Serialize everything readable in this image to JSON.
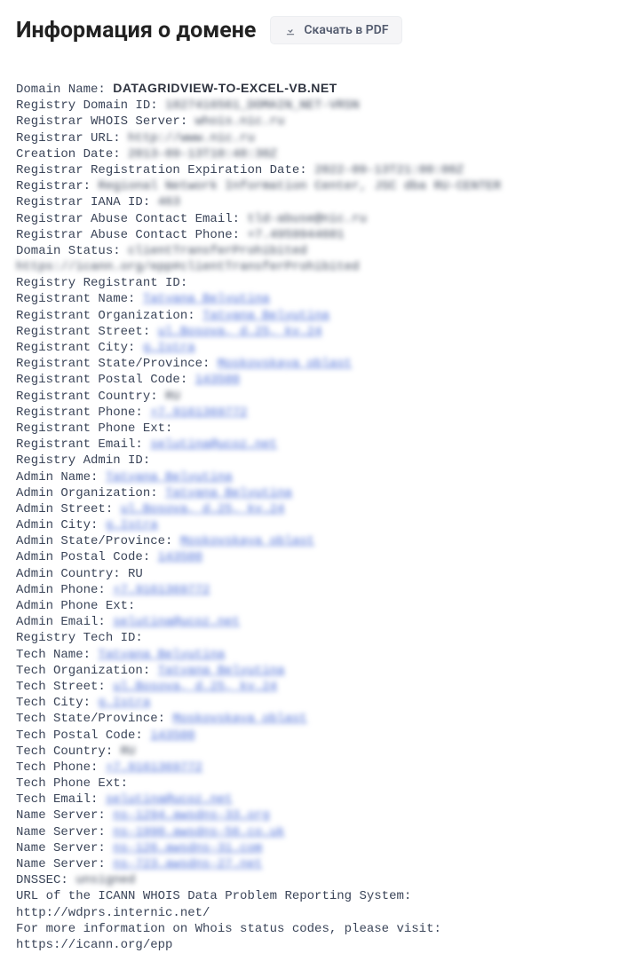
{
  "header": {
    "title": "Информация о домене",
    "pdf_button": "Скачать в PDF"
  },
  "whois": {
    "domain_name_label": "Domain Name:",
    "domain_name_value": "DATAGRIDVIEW-TO-EXCEL-VB.NET",
    "registry_domain_id_label": "Registry Domain ID:",
    "registry_domain_id_value": "1827416561_DOMAIN_NET-VRSN",
    "registrar_whois_server_label": "Registrar WHOIS Server:",
    "registrar_whois_server_value": "whois.nic.ru",
    "registrar_url_label": "Registrar URL:",
    "registrar_url_value": "http://www.nic.ru",
    "creation_date_label": "Creation Date:",
    "creation_date_value": "2013-09-13T10:48:30Z",
    "expiration_date_label": "Registrar Registration Expiration Date:",
    "expiration_date_value": "2022-09-13T21:00:00Z",
    "registrar_label": "Registrar:",
    "registrar_value": "Regional Network Information Center, JSC dba RU-CENTER",
    "registrar_iana_id_label": "Registrar IANA ID:",
    "registrar_iana_id_value": "463",
    "registrar_abuse_email_label": "Registrar Abuse Contact Email:",
    "registrar_abuse_email_value": "tld-abuse@nic.ru",
    "registrar_abuse_phone_label": "Registrar Abuse Contact Phone:",
    "registrar_abuse_phone_value": "+7.4959944601",
    "domain_status_label": "Domain Status:",
    "domain_status_value": "clientTransferProhibited https://icann.org/epp#clientTransferProhibited",
    "registry_registrant_id_label": "Registry Registrant ID:",
    "registrant_name_label": "Registrant Name:",
    "registrant_name_value": "Tatyana Belyutina",
    "registrant_org_label": "Registrant Organization:",
    "registrant_org_value": "Tatyana Belyutina",
    "registrant_street_label": "Registrant Street:",
    "registrant_street_value": "ul.Bosova, d.25, kv.24",
    "registrant_city_label": "Registrant City:",
    "registrant_city_value": "g.Istra",
    "registrant_state_label": "Registrant State/Province:",
    "registrant_state_value": "Moskovskaya oblast",
    "registrant_postal_label": "Registrant Postal Code:",
    "registrant_postal_value": "143500",
    "registrant_country_label": "Registrant Country:",
    "registrant_country_value": "RU",
    "registrant_phone_label": "Registrant Phone:",
    "registrant_phone_value": "+7.9161369772",
    "registrant_phone_ext_label": "Registrant Phone Ext:",
    "registrant_email_label": "Registrant Email:",
    "registrant_email_value": "selutina@ucoz.net",
    "registry_admin_id_label": "Registry Admin ID:",
    "admin_name_label": "Admin Name:",
    "admin_name_value": "Tatyana Belyutina",
    "admin_org_label": "Admin Organization:",
    "admin_org_value": "Tatyana Belyutina",
    "admin_street_label": "Admin Street:",
    "admin_street_value": "ul.Bosova, d.25, kv.24",
    "admin_city_label": "Admin City:",
    "admin_city_value": "g.Istra",
    "admin_state_label": "Admin State/Province:",
    "admin_state_value": "Moskovskaya oblast",
    "admin_postal_label": "Admin Postal Code:",
    "admin_postal_value": "143500",
    "admin_country_label": "Admin Country: RU",
    "admin_phone_label": "Admin Phone:",
    "admin_phone_value": "+7.9161369772",
    "admin_phone_ext_label": "Admin Phone Ext:",
    "admin_email_label": "Admin Email:",
    "admin_email_value": "selutina@ucoz.net",
    "registry_tech_id_label": "Registry Tech ID:",
    "tech_name_label": "Tech Name:",
    "tech_name_value": "Tatyana Belyutina",
    "tech_org_label": "Tech Organization:",
    "tech_org_value": "Tatyana Belyutina",
    "tech_street_label": "Tech Street:",
    "tech_street_value": "ul.Bosova, d.25, kv.24",
    "tech_city_label": "Tech City:",
    "tech_city_value": "g.Istra",
    "tech_state_label": "Tech State/Province:",
    "tech_state_value": "Moskovskaya oblast",
    "tech_postal_label": "Tech Postal Code:",
    "tech_postal_value": "143500",
    "tech_country_label": "Tech Country:",
    "tech_country_value": "RU",
    "tech_phone_label": "Tech Phone:",
    "tech_phone_value": "+7.9161369772",
    "tech_phone_ext_label": "Tech Phone Ext:",
    "tech_email_label": "Tech Email:",
    "tech_email_value": "selutina@ucoz.net",
    "ns_label": "Name Server:",
    "ns1_value": "ns-1294.awsdns-33.org",
    "ns2_value": "ns-1990.awsdns-56.co.uk",
    "ns3_value": "ns-126.awsdns-31.com",
    "ns4_value": "ns-723.awsdns-27.net",
    "dnssec_label": "DNSSEC:",
    "dnssec_value": "unsigned",
    "icann_problem_line1": "URL of the ICANN WHOIS Data Problem Reporting System:",
    "icann_problem_line2": "http://wdprs.internic.net/",
    "more_info_line1": "For more information on Whois status codes, please visit:",
    "more_info_line2": "https://icann.org/epp"
  }
}
